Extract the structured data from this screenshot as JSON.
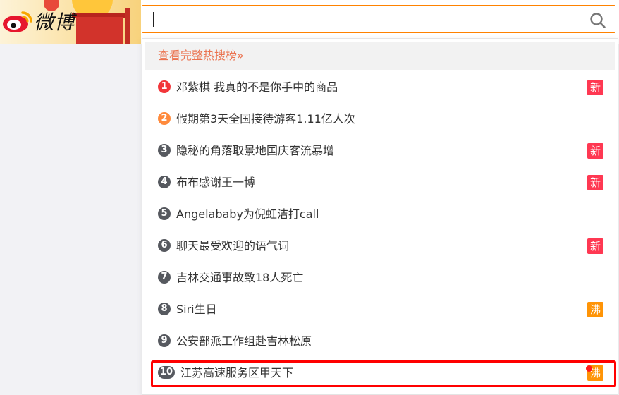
{
  "header": {
    "logo_text": "微博",
    "search_value": ""
  },
  "dropdown": {
    "full_list_link": "查看完整热搜榜»",
    "items": [
      {
        "rank": "1",
        "title": "邓紫棋 我真的不是你手中的商品",
        "badge": "新",
        "badge_type": "new",
        "rank_color": "#f2363a"
      },
      {
        "rank": "2",
        "title": "假期第3天全国接待游客1.11亿人次",
        "badge": "",
        "badge_type": "",
        "rank_color": "#ff8a3c"
      },
      {
        "rank": "3",
        "title": "隐秘的角落取景地国庆客流暴增",
        "badge": "新",
        "badge_type": "new",
        "rank_color": "#56595f"
      },
      {
        "rank": "4",
        "title": "布布感谢王一博",
        "badge": "新",
        "badge_type": "new",
        "rank_color": "#56595f"
      },
      {
        "rank": "5",
        "title": "Angelababy为倪虹洁打call",
        "badge": "",
        "badge_type": "",
        "rank_color": "#56595f"
      },
      {
        "rank": "6",
        "title": "聊天最受欢迎的语气词",
        "badge": "新",
        "badge_type": "new",
        "rank_color": "#56595f"
      },
      {
        "rank": "7",
        "title": "吉林交通事故致18人死亡",
        "badge": "",
        "badge_type": "",
        "rank_color": "#56595f"
      },
      {
        "rank": "8",
        "title": "Siri生日",
        "badge": "沸",
        "badge_type": "hot",
        "rank_color": "#56595f"
      },
      {
        "rank": "9",
        "title": "公安部派工作组赴吉林松原",
        "badge": "",
        "badge_type": "",
        "rank_color": "#56595f"
      },
      {
        "rank": "10",
        "title": "江苏高速服务区甲天下",
        "badge": "沸",
        "badge_type": "hot",
        "rank_color": "#56595f"
      }
    ]
  },
  "colors": {
    "accent_orange": "#ff8200",
    "link_orange": "#eb7350",
    "badge_new": "#ff3852",
    "badge_hot": "#ff9406",
    "highlight_red": "#ff0000"
  }
}
